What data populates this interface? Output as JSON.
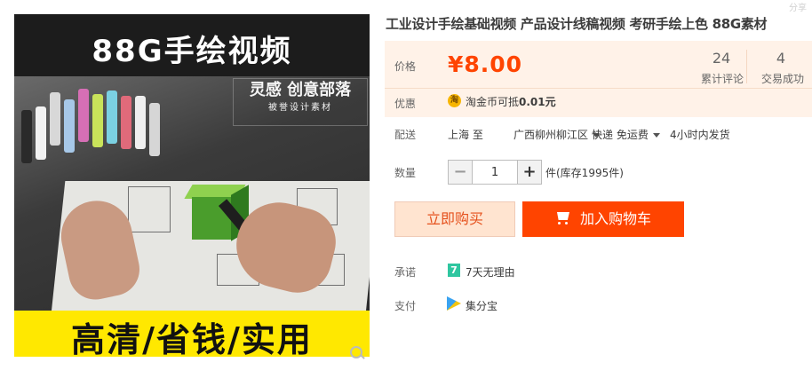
{
  "product_image": {
    "top_title": "88G手绘视频",
    "watermark_line1": "灵感 创意部落",
    "watermark_line2": "被誉设计素材",
    "bottom_text": "高清/省钱/实用"
  },
  "top_right_mark": "分享",
  "title": "工业设计手绘基础视频 产品设计线稿视频 考研手绘上色 88G素材",
  "price": {
    "label": "价格",
    "value": "¥8.00",
    "color": "#ff4400"
  },
  "stats": [
    {
      "number": "24",
      "label": "累计评论"
    },
    {
      "number": "4",
      "label": "交易成功"
    }
  ],
  "coupon": {
    "label": "优惠",
    "icon": "taobao-coin-icon",
    "icon_glyph": "淘",
    "text": "淘金币可抵",
    "amount": "0.01元"
  },
  "shipping": {
    "label": "配送",
    "from": "上海 至",
    "to": "广西柳州柳江区",
    "method": "快递 免运费",
    "dispatch": "4小时内发货"
  },
  "quantity": {
    "label": "数量",
    "minus": "−",
    "value": "1",
    "plus": "+",
    "stock": "件(库存1995件)"
  },
  "buttons": {
    "buy_now": "立即购买",
    "add_cart": "加入购物车",
    "accent": "#ff4400"
  },
  "promise": {
    "label": "承诺",
    "icon_glyph": "7",
    "text": "7天无理由"
  },
  "payment": {
    "label": "支付",
    "text": "集分宝"
  }
}
